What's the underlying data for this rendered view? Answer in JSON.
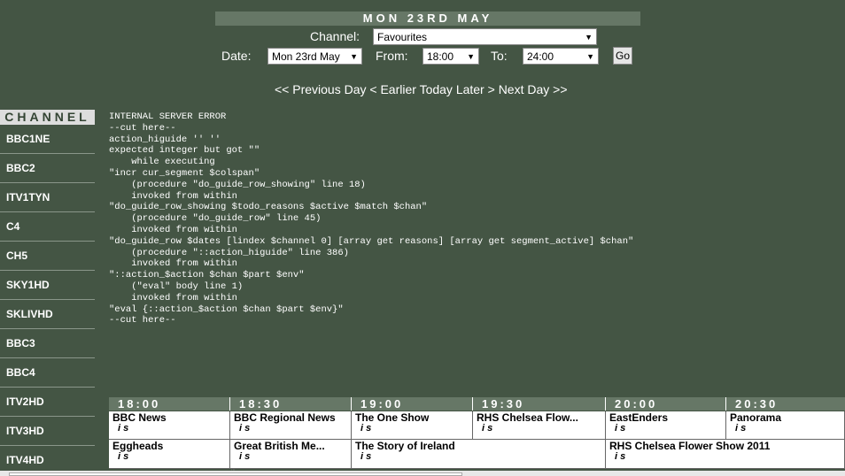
{
  "header": {
    "title": "MON 23RD MAY",
    "channel_label": "Channel:",
    "channel_value": "Favourites",
    "date_label": "Date:",
    "date_value": "Mon 23rd May",
    "from_label": "From:",
    "from_value": "18:00",
    "to_label": "To:",
    "to_value": "24:00",
    "go_label": "Go"
  },
  "nav": {
    "prev_day": "<< Previous Day",
    "earlier": "< Earlier",
    "today": "Today",
    "later": "Later >",
    "next_day": "Next Day >>"
  },
  "channel_header": "CHANNEL",
  "channels": [
    "BBC1NE",
    "BBC2",
    "ITV1TYN",
    "C4",
    "CH5",
    "SKY1HD",
    "SKLIVHD",
    "BBC3",
    "BBC4",
    "ITV2HD",
    "ITV3HD",
    "ITV4HD"
  ],
  "error_text": "INTERNAL SERVER ERROR\n--cut here--\naction_higuide '' ''\nexpected integer but got \"\"\n    while executing\n\"incr cur_segment $colspan\"\n    (procedure \"do_guide_row_showing\" line 18)\n    invoked from within\n\"do_guide_row_showing $todo_reasons $active $match $chan\"\n    (procedure \"do_guide_row\" line 45)\n    invoked from within\n\"do_guide_row $dates [lindex $channel 0] [array get reasons] [array get segment_active] $chan\"\n    (procedure \"::action_higuide\" line 386)\n    invoked from within\n\"::action_$action $chan $part $env\"\n    (\"eval\" body line 1)\n    invoked from within\n\"eval {::action_$action $chan $part $env}\"\n--cut here--",
  "time_slots": [
    "18:00",
    "18:30",
    "19:00",
    "19:30",
    "20:00",
    "20:30"
  ],
  "guide_rows": [
    [
      {
        "title": "BBC News",
        "flags": "i s"
      },
      {
        "title": "BBC Regional News",
        "flags": "i s"
      },
      {
        "title": "The One Show",
        "flags": "i s"
      },
      {
        "title": "RHS Chelsea Flow...",
        "flags": "i s"
      },
      {
        "title": "EastEnders",
        "flags": "i s"
      },
      {
        "title": "Panorama",
        "flags": "i s"
      }
    ],
    [
      {
        "title": "Eggheads",
        "flags": "i s"
      },
      {
        "title": "Great British Me...",
        "flags": "i s"
      },
      {
        "title": "The Story of Ireland",
        "flags": "i s"
      },
      {
        "title": "RHS Chelsea Flower Show 2011",
        "flags": "i s"
      }
    ]
  ],
  "colors": {
    "background": "#445544",
    "header_bar": "#667766",
    "channel_header_bg": "#dddddd"
  },
  "scrollbar": {
    "thumb_label": "'''"
  }
}
